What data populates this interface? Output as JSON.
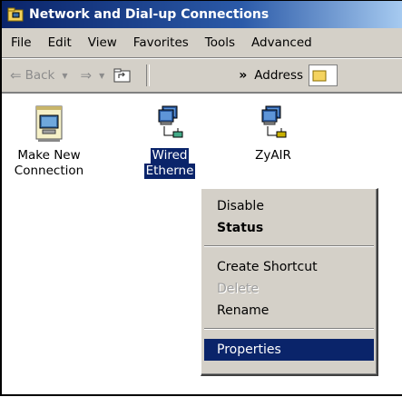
{
  "window": {
    "title": "Network and Dial-up Connections"
  },
  "menubar": {
    "items": [
      "File",
      "Edit",
      "View",
      "Favorites",
      "Tools",
      "Advanced"
    ]
  },
  "toolbar": {
    "back_label": "Back",
    "chevron": "»",
    "address_label": "Address"
  },
  "icons": [
    {
      "label_line1": "Make New",
      "label_line2": "Connection",
      "icon": "make-new-connection-icon"
    },
    {
      "label_line1": "Wired",
      "label_line2": "Etherne",
      "icon": "wired-ethernet-icon",
      "selected": true
    },
    {
      "label_line1": "ZyAIR",
      "label_line2": "",
      "icon": "zyair-connection-icon"
    }
  ],
  "context_menu": {
    "items": [
      {
        "label": "Disable"
      },
      {
        "label": "Status",
        "bold": true
      },
      {
        "label": "Create Shortcut"
      },
      {
        "label": "Delete",
        "disabled": true
      },
      {
        "label": "Rename"
      },
      {
        "label": "Properties",
        "highlighted": true
      }
    ]
  }
}
